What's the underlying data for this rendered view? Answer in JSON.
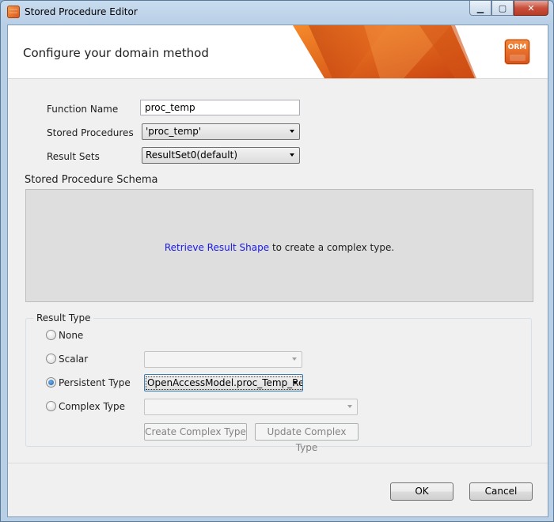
{
  "window": {
    "title": "Stored Procedure Editor",
    "minimize_icon": "minimize-icon",
    "maximize_icon": "maximize-icon",
    "close_icon": "close-icon"
  },
  "header": {
    "title": "Configure your domain method",
    "badge": "ORM"
  },
  "form": {
    "function_name_label": "Function Name",
    "function_name_value": "proc_temp",
    "stored_procedures_label": "Stored Procedures",
    "stored_procedures_value": "'proc_temp'",
    "result_sets_label": "Result Sets",
    "result_sets_value": "ResultSet0(default)"
  },
  "schema": {
    "title": "Stored Procedure Schema",
    "link_text": "Retrieve Result Shape",
    "message_suffix": " to create a complex type."
  },
  "result_type": {
    "legend": "Result Type",
    "options": [
      {
        "label": "None",
        "checked": false
      },
      {
        "label": "Scalar",
        "checked": false
      },
      {
        "label": "Persistent Type",
        "checked": true
      },
      {
        "label": "Complex Type",
        "checked": false
      }
    ],
    "persistent_type_value": "OpenAccessModel.proc_Temp_Re",
    "create_button": "Create Complex Type",
    "update_button": "Update Complex Type"
  },
  "footer": {
    "ok": "OK",
    "cancel": "Cancel"
  },
  "colors": {
    "accent_orange": "#d9531a",
    "link_blue": "#1a1ae6"
  }
}
